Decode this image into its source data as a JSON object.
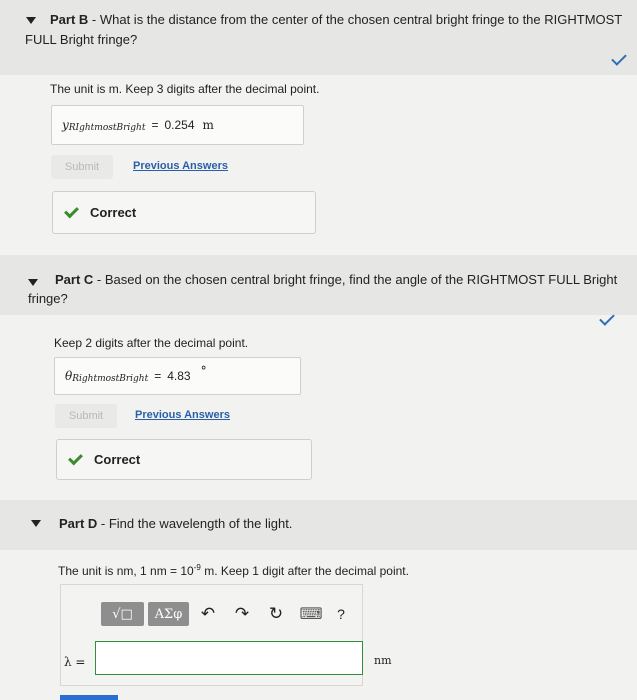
{
  "partB": {
    "label": "Part B",
    "question": " - What is the distance from the center of the chosen central bright fringe to the RIGHTMOST",
    "question2": "FULL Bright fringe?",
    "instruction": "The unit is m. Keep 3 digits after the decimal point.",
    "var": "y",
    "sub": "RIghtmostBright",
    "value": "0.254",
    "unit": "m",
    "submit": "Submit",
    "previous": "Previous Answers",
    "correct": "Correct"
  },
  "partC": {
    "label": "Part C",
    "question": " - Based on the chosen central bright fringe, find the angle of the RIGHTMOST FULL Bright",
    "question2": "fringe?",
    "instruction": "Keep 2 digits after the decimal point.",
    "var": "θ",
    "sub": "RightmostBright",
    "value": "4.83",
    "unit": "°",
    "submit": "Submit",
    "previous": "Previous Answers",
    "correct": "Correct"
  },
  "partD": {
    "label": "Part D",
    "question": " - Find the wavelength of the light.",
    "instruction_pre": "The unit is nm, 1 nm = 10",
    "instruction_exp": "-9",
    "instruction_post": " m. Keep 1 digit after the decimal point.",
    "toolbar": {
      "templates": "√□",
      "symbols": "ΑΣφ",
      "undo": "↶",
      "redo": "↷",
      "reset": "↻",
      "keyboard": "⌨",
      "help": "?"
    },
    "input_label": "λ =",
    "input_value": "",
    "unit": "nm"
  },
  "colors": {
    "link": "#2a5fa8",
    "check_top": "#2c6fb7",
    "check_correct": "#3b8a2e",
    "input_border": "#2f8f3a"
  }
}
